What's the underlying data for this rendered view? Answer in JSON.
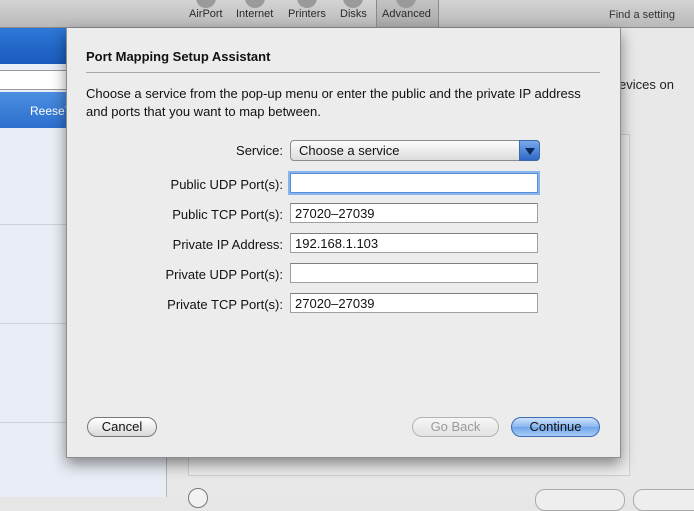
{
  "toolbar": {
    "items": [
      "AirPort",
      "Internet",
      "Printers",
      "Disks",
      "Advanced"
    ],
    "search_placeholder": "Find a setting"
  },
  "sidebar": {
    "selected_label": "ReeseT"
  },
  "background": {
    "right_text_1": "evices on"
  },
  "sheet": {
    "title": "Port Mapping Setup Assistant",
    "description": "Choose a service from the pop-up menu or enter the public and the private IP address and ports that you want to map between.",
    "service": {
      "label": "Service:",
      "selected": "Choose a service"
    },
    "fields": [
      {
        "label": "Public UDP Port(s):",
        "value": ""
      },
      {
        "label": "Public TCP Port(s):",
        "value": "27020–27039"
      },
      {
        "label": "Private IP Address:",
        "value": "192.168.1.103"
      },
      {
        "label": "Private UDP Port(s):",
        "value": ""
      },
      {
        "label": "Private TCP Port(s):",
        "value": "27020–27039"
      }
    ],
    "buttons": {
      "cancel": "Cancel",
      "go_back": "Go Back",
      "continue": "Continue"
    }
  },
  "colors": {
    "accent": "#3c6cb4",
    "sidebar_selection": "#2c6fcf",
    "sheet_bg": "#ececec"
  }
}
